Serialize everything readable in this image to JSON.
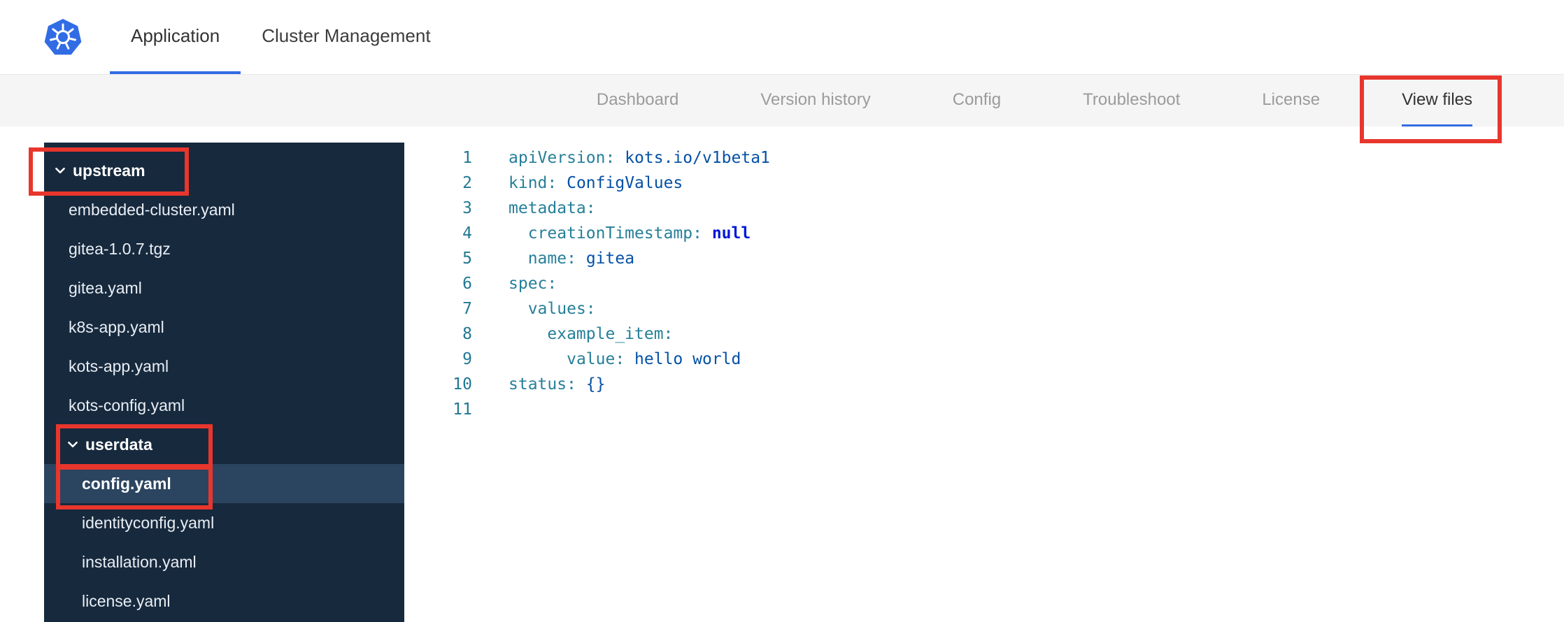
{
  "theme": {
    "accent_blue": "#326ce5",
    "sidebar_bg": "#17293d",
    "sidebar_selected_bg": "#2b4560",
    "subnav_bg": "#f5f5f5",
    "inactive_tab_text": "#9b9b9b",
    "active_tab_text": "#323232",
    "annotation_red": "#e8362d"
  },
  "topnav": {
    "tabs": [
      {
        "label": "Application",
        "active": true
      },
      {
        "label": "Cluster Management",
        "active": false
      }
    ]
  },
  "subnav": {
    "tabs": [
      {
        "label": "Dashboard",
        "active": false
      },
      {
        "label": "Version history",
        "active": false
      },
      {
        "label": "Config",
        "active": false
      },
      {
        "label": "Troubleshoot",
        "active": false
      },
      {
        "label": "License",
        "active": false
      },
      {
        "label": "View files",
        "active": true
      }
    ]
  },
  "file_tree": {
    "items": [
      {
        "kind": "folder",
        "label": "upstream",
        "expanded": true,
        "depth": 0,
        "selected": false
      },
      {
        "kind": "file",
        "label": "embedded-cluster.yaml",
        "depth": 1,
        "selected": false
      },
      {
        "kind": "file",
        "label": "gitea-1.0.7.tgz",
        "depth": 1,
        "selected": false
      },
      {
        "kind": "file",
        "label": "gitea.yaml",
        "depth": 1,
        "selected": false
      },
      {
        "kind": "file",
        "label": "k8s-app.yaml",
        "depth": 1,
        "selected": false
      },
      {
        "kind": "file",
        "label": "kots-app.yaml",
        "depth": 1,
        "selected": false
      },
      {
        "kind": "file",
        "label": "kots-config.yaml",
        "depth": 1,
        "selected": false
      },
      {
        "kind": "folder",
        "label": "userdata",
        "expanded": true,
        "depth": 1,
        "selected": false
      },
      {
        "kind": "file",
        "label": "config.yaml",
        "depth": 2,
        "selected": true
      },
      {
        "kind": "file",
        "label": "identityconfig.yaml",
        "depth": 2,
        "selected": false
      },
      {
        "kind": "file",
        "label": "installation.yaml",
        "depth": 2,
        "selected": false
      },
      {
        "kind": "file",
        "label": "license.yaml",
        "depth": 2,
        "selected": false
      }
    ]
  },
  "editor": {
    "language": "yaml",
    "colors": {
      "key": "#267f99",
      "value": "#0451a5",
      "keyword": "#0018d6",
      "line_number": "#237893"
    },
    "lines": [
      {
        "n": 1,
        "tokens": [
          {
            "t": "apiVersion:",
            "c": "key"
          },
          {
            "t": " ",
            "c": "plain"
          },
          {
            "t": "kots.io/v1beta1",
            "c": "value"
          }
        ]
      },
      {
        "n": 2,
        "tokens": [
          {
            "t": "kind:",
            "c": "key"
          },
          {
            "t": " ",
            "c": "plain"
          },
          {
            "t": "ConfigValues",
            "c": "value"
          }
        ]
      },
      {
        "n": 3,
        "tokens": [
          {
            "t": "metadata:",
            "c": "key"
          }
        ]
      },
      {
        "n": 4,
        "tokens": [
          {
            "t": "  ",
            "c": "plain"
          },
          {
            "t": "creationTimestamp:",
            "c": "key"
          },
          {
            "t": " ",
            "c": "plain"
          },
          {
            "t": "null",
            "c": "kw"
          }
        ]
      },
      {
        "n": 5,
        "tokens": [
          {
            "t": "  ",
            "c": "plain"
          },
          {
            "t": "name:",
            "c": "key"
          },
          {
            "t": " ",
            "c": "plain"
          },
          {
            "t": "gitea",
            "c": "value"
          }
        ]
      },
      {
        "n": 6,
        "tokens": [
          {
            "t": "spec:",
            "c": "key"
          }
        ]
      },
      {
        "n": 7,
        "tokens": [
          {
            "t": "  ",
            "c": "plain"
          },
          {
            "t": "values:",
            "c": "key"
          }
        ]
      },
      {
        "n": 8,
        "tokens": [
          {
            "t": "    ",
            "c": "plain"
          },
          {
            "t": "example_item:",
            "c": "key"
          }
        ]
      },
      {
        "n": 9,
        "tokens": [
          {
            "t": "      ",
            "c": "plain"
          },
          {
            "t": "value:",
            "c": "key"
          },
          {
            "t": " ",
            "c": "plain"
          },
          {
            "t": "hello world",
            "c": "value"
          }
        ]
      },
      {
        "n": 10,
        "tokens": [
          {
            "t": "status:",
            "c": "key"
          },
          {
            "t": " ",
            "c": "plain"
          },
          {
            "t": "{}",
            "c": "value"
          }
        ]
      },
      {
        "n": 11,
        "tokens": []
      }
    ]
  },
  "annotations": {
    "boxes": [
      {
        "name": "view-files-tab"
      },
      {
        "name": "upstream-folder"
      },
      {
        "name": "userdata-folder"
      },
      {
        "name": "config-yaml-file"
      }
    ]
  }
}
